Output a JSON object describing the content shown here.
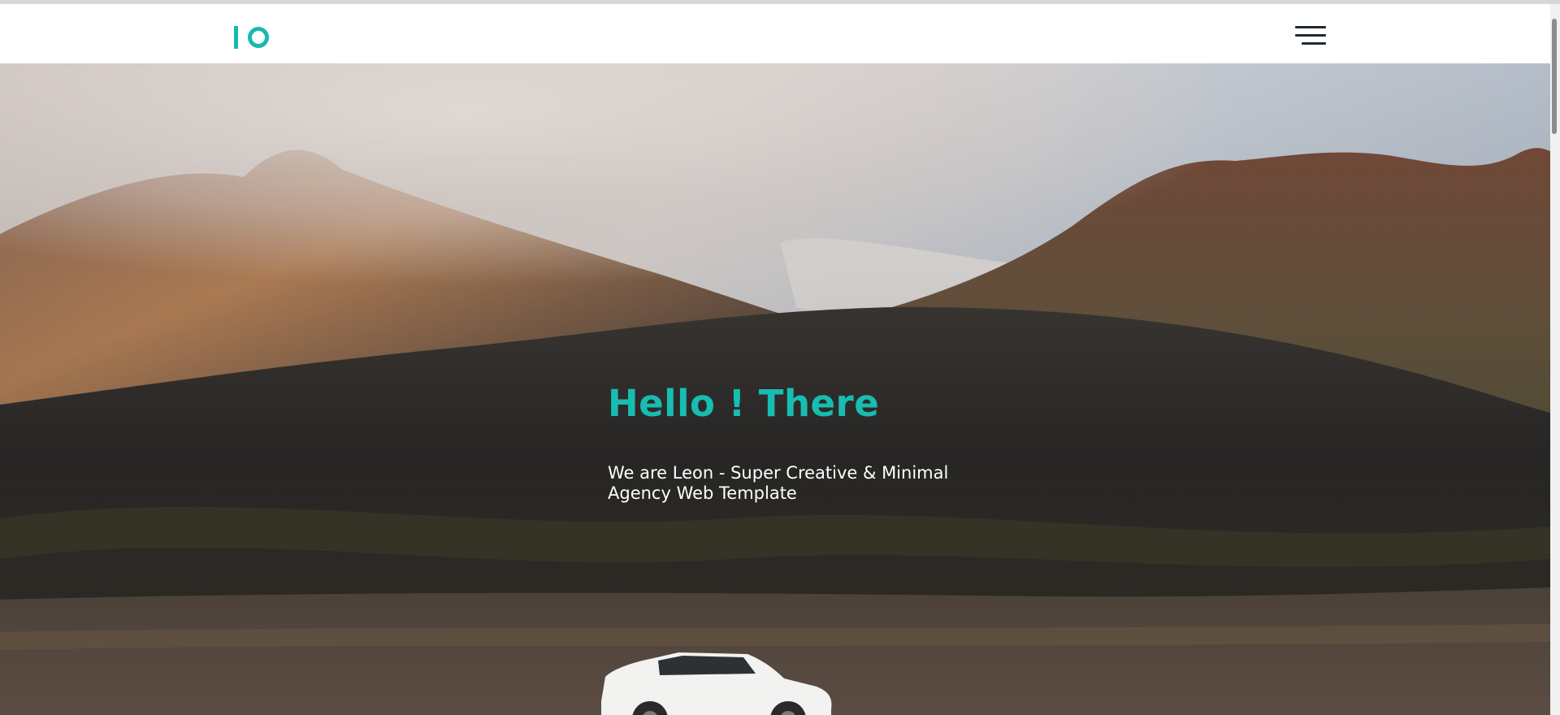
{
  "header": {
    "logo_icon": "io-logo-icon",
    "menu_icon": "hamburger-menu-icon"
  },
  "hero": {
    "title": "Hello ! There",
    "subtitle": "We are Leon - Super Creative & Minimal Agency Web Template",
    "background_image": "mountain-landscape-with-white-suv-photo"
  },
  "colors": {
    "accent": "#16bab0",
    "text_on_hero": "#ffffff",
    "menu_lines": "#1f2a33"
  }
}
